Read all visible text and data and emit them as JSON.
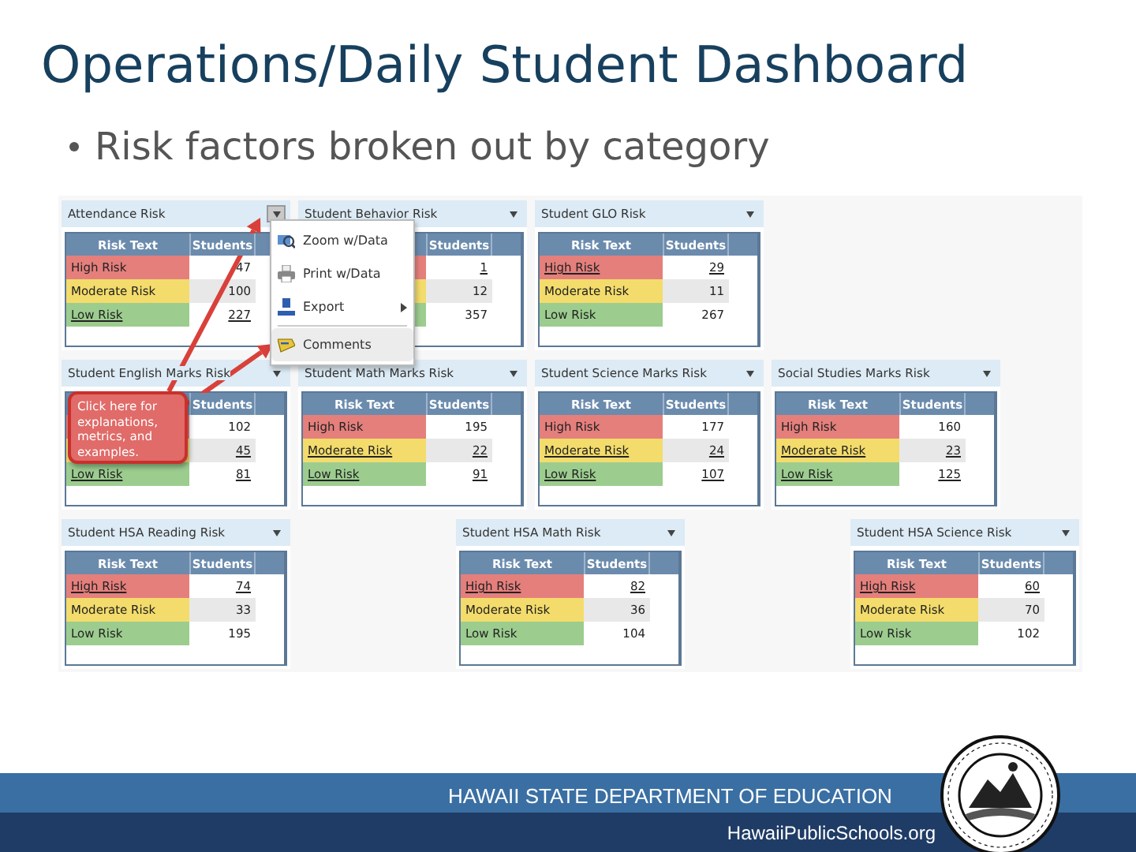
{
  "slide": {
    "title": "Operations/Daily Student Dashboard",
    "bullet": "Risk factors broken out by category"
  },
  "dashboard": {
    "rows": [
      {
        "panels": [
          {
            "title": "Attendance Risk",
            "menu_open": true,
            "risk_header": "Risk Text",
            "students_header": "Students",
            "rows": [
              {
                "kind": "high",
                "label": "High Risk",
                "students": "47",
                "linked": false
              },
              {
                "kind": "moderate",
                "label": "Moderate Risk",
                "students": "100",
                "linked": false
              },
              {
                "kind": "low",
                "label": "Low Risk",
                "students": "227",
                "linked": true
              }
            ]
          },
          {
            "title": "Student Behavior Risk",
            "menu_open": false,
            "students_header": "Students",
            "rows": [
              {
                "kind": "high",
                "students": "1",
                "linked": true
              },
              {
                "kind": "moderate",
                "students": "12",
                "linked": false
              },
              {
                "kind": "low",
                "students": "357",
                "linked": false
              }
            ]
          },
          {
            "title": "Student GLO Risk",
            "menu_open": false,
            "risk_header": "Risk Text",
            "students_header": "Students",
            "rows": [
              {
                "kind": "high",
                "label": "High Risk",
                "students": "29",
                "linked": true
              },
              {
                "kind": "moderate",
                "label": "Moderate Risk",
                "students": "11",
                "linked": false
              },
              {
                "kind": "low",
                "label": "Low Risk",
                "students": "267",
                "linked": false
              }
            ]
          }
        ]
      },
      {
        "panels": [
          {
            "title": "Student English Marks Risk",
            "menu_open": false,
            "students_header": "Students",
            "rows": [
              {
                "kind": "high",
                "students": "102",
                "linked": false
              },
              {
                "kind": "moderate",
                "students": "45",
                "linked": true
              },
              {
                "kind": "low",
                "label": "Low Risk",
                "students": "81",
                "linked": true
              }
            ]
          },
          {
            "title": "Student Math Marks Risk",
            "menu_open": false,
            "risk_header": "Risk Text",
            "students_header": "Students",
            "rows": [
              {
                "kind": "high",
                "label": "High Risk",
                "students": "195",
                "linked": false
              },
              {
                "kind": "moderate",
                "label": "Moderate Risk",
                "students": "22",
                "linked": true
              },
              {
                "kind": "low",
                "label": "Low Risk",
                "students": "91",
                "linked": true
              }
            ]
          },
          {
            "title": "Student Science Marks Risk",
            "menu_open": false,
            "risk_header": "Risk Text",
            "students_header": "Students",
            "rows": [
              {
                "kind": "high",
                "label": "High Risk",
                "students": "177",
                "linked": false
              },
              {
                "kind": "moderate",
                "label": "Moderate Risk",
                "students": "24",
                "linked": true
              },
              {
                "kind": "low",
                "label": "Low Risk",
                "students": "107",
                "linked": true
              }
            ]
          },
          {
            "title": "Social Studies Marks Risk",
            "menu_open": false,
            "risk_header": "Risk Text",
            "students_header": "Students",
            "rows": [
              {
                "kind": "high",
                "label": "High Risk",
                "students": "160",
                "linked": false
              },
              {
                "kind": "moderate",
                "label": "Moderate Risk",
                "students": "23",
                "linked": true
              },
              {
                "kind": "low",
                "label": "Low Risk",
                "students": "125",
                "linked": true
              }
            ]
          }
        ]
      },
      {
        "panels": [
          {
            "title": "Student HSA Reading Risk",
            "menu_open": false,
            "risk_header": "Risk Text",
            "students_header": "Students",
            "rows": [
              {
                "kind": "high",
                "label": "High Risk",
                "students": "74",
                "linked": true
              },
              {
                "kind": "moderate",
                "label": "Moderate Risk",
                "students": "33",
                "linked": false
              },
              {
                "kind": "low",
                "label": "Low Risk",
                "students": "195",
                "linked": false
              }
            ]
          },
          {
            "title": "Student HSA Math Risk",
            "menu_open": false,
            "risk_header": "Risk Text",
            "students_header": "Students",
            "rows": [
              {
                "kind": "high",
                "label": "High Risk",
                "students": "82",
                "linked": true
              },
              {
                "kind": "moderate",
                "label": "Moderate Risk",
                "students": "36",
                "linked": false
              },
              {
                "kind": "low",
                "label": "Low Risk",
                "students": "104",
                "linked": false
              }
            ]
          },
          {
            "title": "Student HSA Science Risk",
            "menu_open": false,
            "risk_header": "Risk Text",
            "students_header": "Students",
            "rows": [
              {
                "kind": "high",
                "label": "High Risk",
                "students": "60",
                "linked": true
              },
              {
                "kind": "moderate",
                "label": "Moderate Risk",
                "students": "70",
                "linked": false
              },
              {
                "kind": "low",
                "label": "Low Risk",
                "students": "102",
                "linked": false
              }
            ]
          }
        ]
      }
    ],
    "menu": {
      "items": [
        {
          "kind": "zoom",
          "label": "Zoom w/Data",
          "selected": false
        },
        {
          "kind": "print",
          "label": "Print w/Data",
          "selected": false
        },
        {
          "kind": "export",
          "label": "Export",
          "selected": false,
          "submenu": true
        },
        {
          "kind": "comments",
          "label": "Comments",
          "selected": true
        }
      ]
    },
    "callout": {
      "text": "Click here for explanations, metrics, and examples."
    }
  },
  "footer": {
    "department": "HAWAII STATE DEPARTMENT OF EDUCATION",
    "website": "HawaiiPublicSchools.org"
  }
}
